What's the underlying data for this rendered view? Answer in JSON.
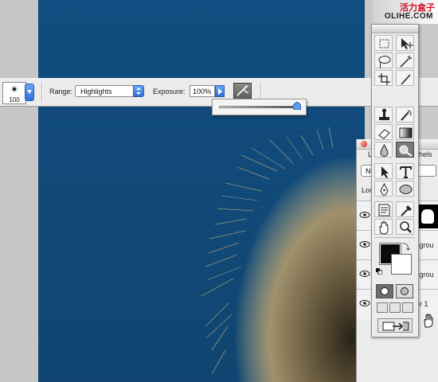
{
  "options_bar": {
    "brush_size": "100",
    "range_label": "Range:",
    "range_value": "Highlights",
    "exposure_label": "Exposure:",
    "exposure_value": "100%",
    "exposure_slider_percent": 100
  },
  "watermark": {
    "text_cn": "活力盒子",
    "text_en": "OLIHE.COM"
  },
  "layers_panel": {
    "tab_layers": "La",
    "tab_channels": "hels",
    "blend_mode": "No",
    "lock_label": "Loc",
    "layers": [
      {
        "name": "",
        "visible": true
      },
      {
        "name": "kgrou",
        "visible": true
      },
      {
        "name": "kgrou",
        "visible": true
      },
      {
        "name": "er 1",
        "visible": true
      }
    ]
  },
  "toolbox": {
    "foreground_color": "#0b0b0b",
    "background_color": "#ffffff",
    "active_tool": "dodge-tool"
  },
  "colors": {
    "canvas_blue": "#0e4877",
    "ui_gray": "#ececec",
    "aqua_blue": "#2f6fd6"
  }
}
